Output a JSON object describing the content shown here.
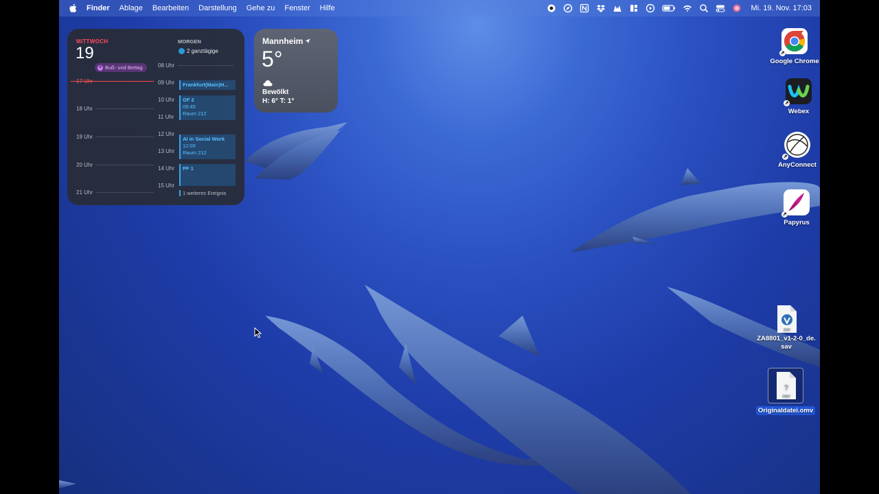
{
  "menubar": {
    "items": [
      "Finder",
      "Ablage",
      "Bearbeiten",
      "Darstellung",
      "Gehe zu",
      "Fenster",
      "Hilfe"
    ],
    "status_icons": [
      "record-icon",
      "compass-icon",
      "notion-icon",
      "dropbox-icon",
      "nordvpn-icon",
      "layout-icon",
      "play-icon",
      "battery-icon",
      "wifi-icon",
      "search-icon",
      "control-center-icon",
      "siri-icon"
    ],
    "clock": "Mi. 19. Nov.  17:03"
  },
  "calendar": {
    "weekday": "MITTWOCH",
    "day": "19",
    "holiday": "Buß- und Bettag",
    "today_hours": [
      "17 Uhr",
      "18 Uhr",
      "19 Uhr",
      "20 Uhr",
      "21 Uhr"
    ],
    "tomorrow_label": "MORGEN",
    "allday": "2 ganztägige",
    "tomorrow_hours": [
      "08 Uhr",
      "09 Uhr",
      "10 Uhr",
      "11 Uhr",
      "12 Uhr",
      "13 Uhr",
      "14 Uhr",
      "15 Uhr"
    ],
    "events": [
      {
        "title": "Frankfurt(Main)H...",
        "time": "",
        "room": ""
      },
      {
        "title": "GF 2",
        "time": "09:45",
        "room": "Raum 212"
      },
      {
        "title": "AI in Social Work",
        "time": "12:00",
        "room": "Raum 212"
      },
      {
        "title": "PF 1",
        "time": "",
        "room": ""
      }
    ],
    "more": "1 weiteres Ereignis"
  },
  "weather": {
    "city": "Mannheim",
    "temp": "5°",
    "condition": "Bewölkt",
    "hilo": "H: 6° T: 1°"
  },
  "desktop_icons": [
    {
      "label": "Google Chrome"
    },
    {
      "label": "Webex"
    },
    {
      "label": "AnyConnect"
    },
    {
      "label": "Papyrus"
    },
    {
      "label": "ZA8801_v1-2-0_de.sav",
      "ext": "SAV"
    },
    {
      "label": "Originaldatei.omv",
      "ext": "OMV"
    }
  ]
}
